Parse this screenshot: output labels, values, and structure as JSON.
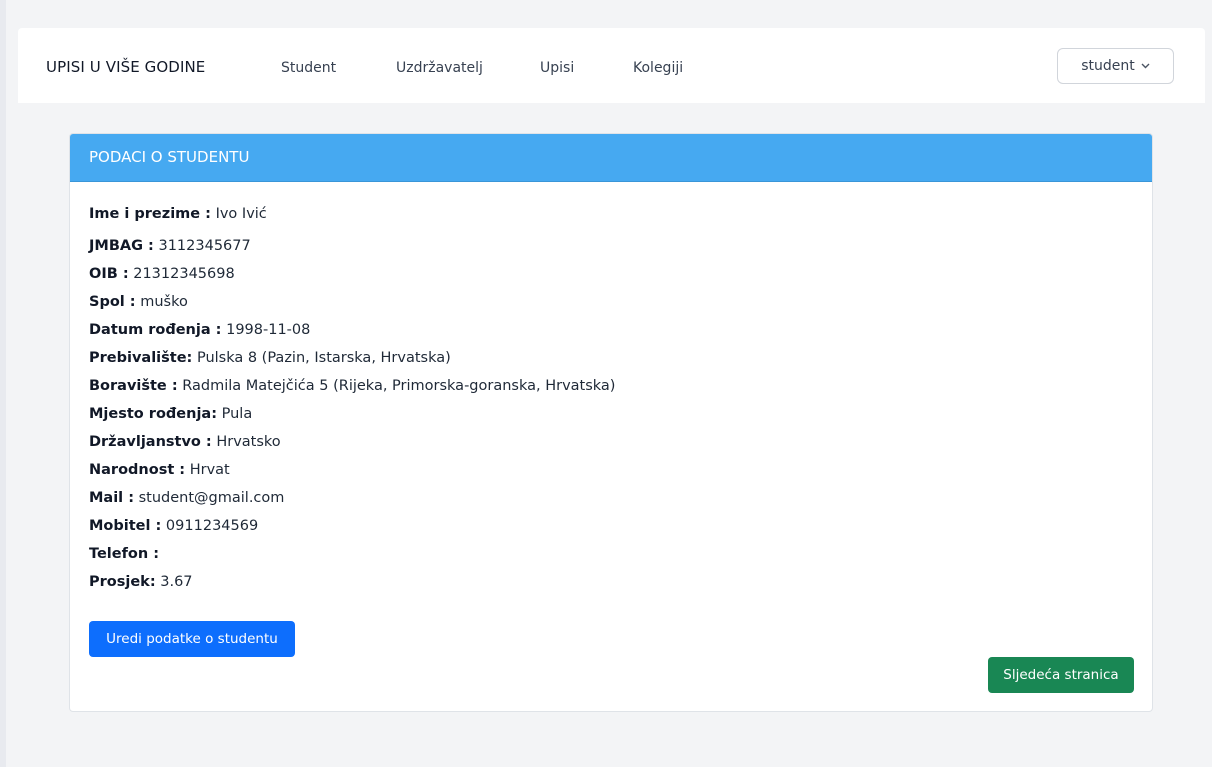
{
  "navbar": {
    "brand": "UPISI U VIŠE GODINE",
    "links": [
      "Student",
      "Uzdržavatelj",
      "Upisi",
      "Kolegiji"
    ],
    "user_menu": "student"
  },
  "card": {
    "title": "PODACI O STUDENTU",
    "fields": [
      {
        "key": "Ime i prezime :",
        "value": " Ivo Ivić"
      },
      {
        "key": "JMBAG :",
        "value": " 3112345677"
      },
      {
        "key": "OIB :",
        "value": " 21312345698"
      },
      {
        "key": "Spol :",
        "value": " muško"
      },
      {
        "key": "Datum rođenja :",
        "value": " 1998-11-08"
      },
      {
        "key": "Prebivalište:",
        "value": " Pulska 8 (Pazin, Istarska, Hrvatska)"
      },
      {
        "key": "Boravište :",
        "value": " Radmila Matejčića 5 (Rijeka, Primorska-goranska, Hrvatska)"
      },
      {
        "key": "Mjesto rođenja:",
        "value": " Pula"
      },
      {
        "key": "Državljanstvo :",
        "value": " Hrvatsko"
      },
      {
        "key": "Narodnost :",
        "value": " Hrvat"
      },
      {
        "key": "Mail :",
        "value": " student@gmail.com"
      },
      {
        "key": "Mobitel :",
        "value": " 0911234569"
      },
      {
        "key": "Telefon :",
        "value": ""
      },
      {
        "key": "Prosjek:",
        "value": " 3.67"
      }
    ],
    "edit_button": "Uredi podatke o studentu",
    "next_button": "Sljedeća stranica"
  },
  "colors": {
    "header": "#46a9f1",
    "edit_button": "#0d6efd",
    "next_button": "#198754"
  }
}
